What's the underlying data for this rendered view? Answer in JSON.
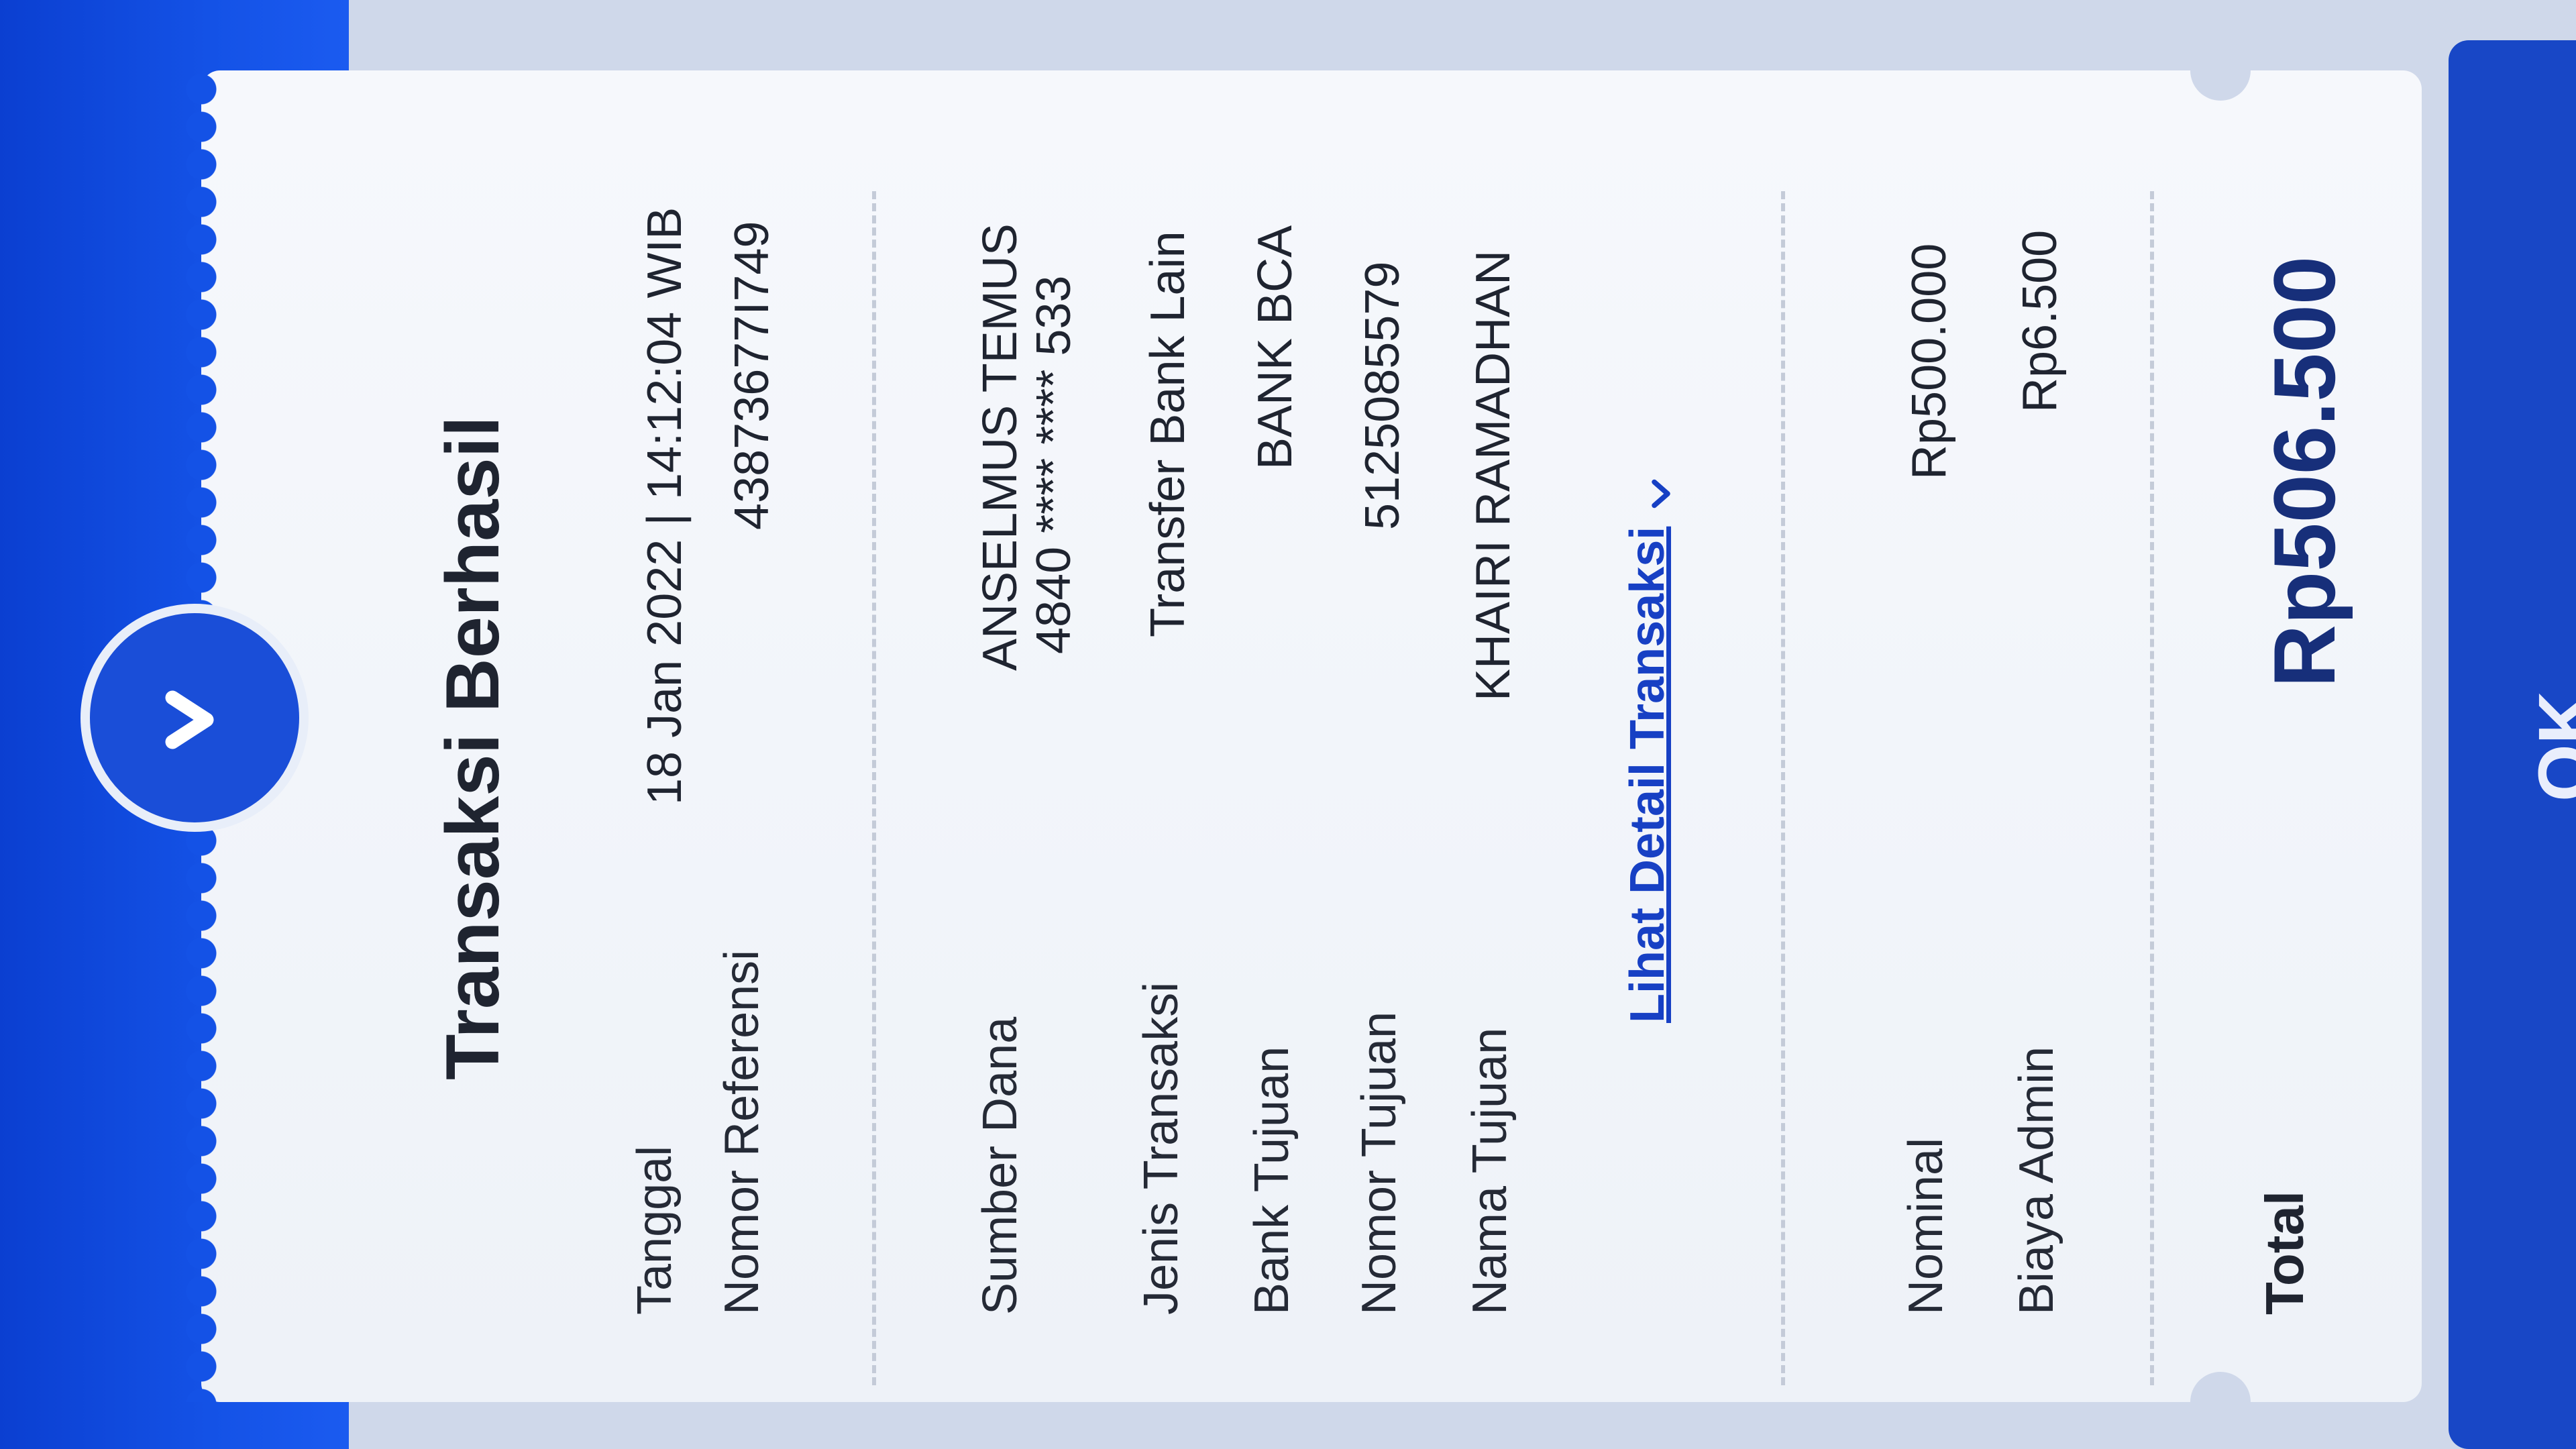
{
  "receipt": {
    "title": "Transaksi Berhasil",
    "rows_top": [
      {
        "label": "Tanggal",
        "value": "18 Jan 2022 | 14:12:04 WIB"
      },
      {
        "label": "Nomor Referensi",
        "value": "43873677I749"
      }
    ],
    "rows_mid": [
      {
        "label": "Sumber Dana",
        "value": "ANSELMUS TEMUS",
        "value2": "4840 **** **** 533"
      },
      {
        "label": "Jenis Transaksi",
        "value": "Transfer Bank Lain"
      },
      {
        "label": "Bank Tujuan",
        "value": "BANK BCA"
      },
      {
        "label": "Nomor Tujuan",
        "value": "5125085579"
      },
      {
        "label": "Nama Tujuan",
        "value": "KHAIRI RAMADHAN"
      }
    ],
    "detail_link": "Lihat Detail Transaksi",
    "rows_bottom": [
      {
        "label": "Nominal",
        "value": "Rp500.000"
      },
      {
        "label": "Biaya Admin",
        "value": "Rp6.500"
      }
    ],
    "total_label": "Total",
    "total_value": "Rp506.500"
  },
  "ok_button": "OK",
  "icons": {
    "status": "checkmark-icon",
    "link_chevron": "chevron-down-icon"
  },
  "colors": {
    "brand_blue": "#1452e6",
    "total_value": "#172f7a",
    "link": "#1740c4"
  }
}
